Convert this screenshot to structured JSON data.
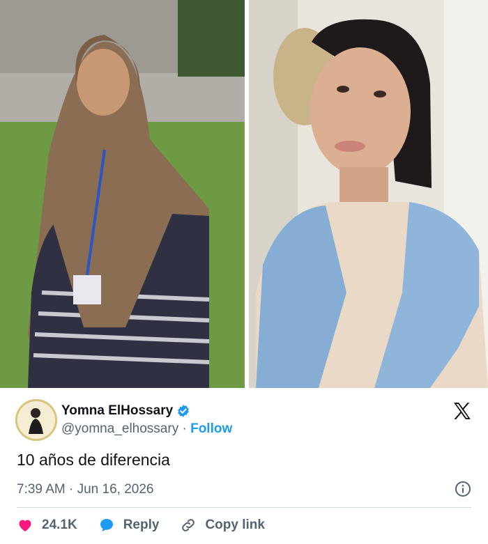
{
  "tweet": {
    "display_name": "Yomna ElHossary",
    "handle": "@yomna_elhossary",
    "separator": "·",
    "follow_label": "Follow",
    "text": "10 años de diferencia",
    "timestamp": "7:39 AM · Jun 16, 2026",
    "likes": "24.1K",
    "reply_label": "Reply",
    "copy_link_label": "Copy link"
  },
  "icons": {
    "verified": "verified-badge-icon",
    "x_logo": "x-logo-icon",
    "info": "info-icon",
    "heart": "heart-icon",
    "reply": "reply-bubble-icon",
    "link": "link-icon"
  },
  "colors": {
    "accent": "#1d9bf0",
    "like": "#f91880",
    "muted": "#536471"
  }
}
